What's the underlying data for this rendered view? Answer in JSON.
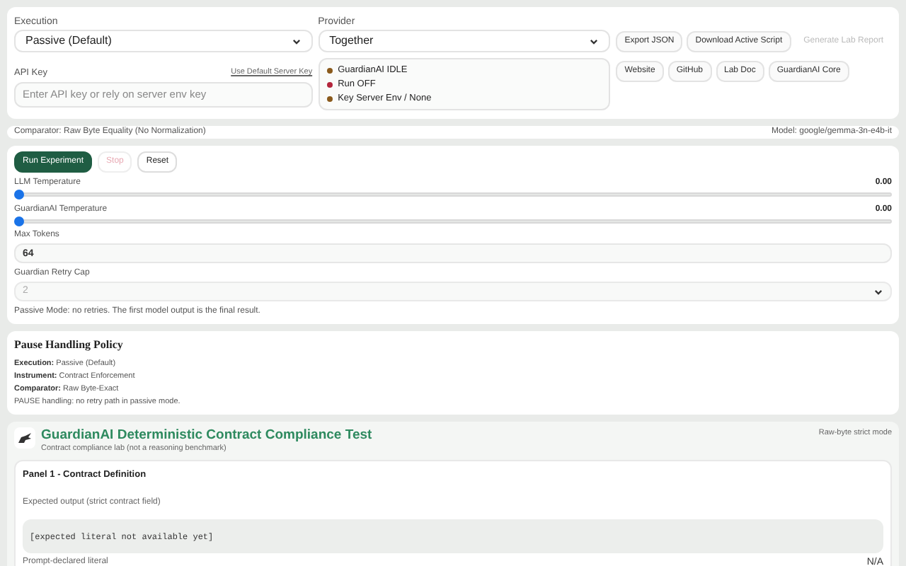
{
  "config": {
    "execution": {
      "label": "Execution",
      "value": "Passive (Default)"
    },
    "provider": {
      "label": "Provider",
      "value": "Together"
    },
    "api_key": {
      "label": "API Key",
      "link": "Use Default Server Key",
      "placeholder": "Enter API key or rely on server env key"
    },
    "status": [
      {
        "text": "GuardianAI IDLE",
        "color": "#8a5a1c"
      },
      {
        "text": "Run OFF",
        "color": "#b3263c"
      },
      {
        "text": "Key Server Env / None",
        "color": "#8a5a1c"
      }
    ],
    "actions": [
      {
        "label": "Export JSON",
        "disabled": false
      },
      {
        "label": "Download Active Script",
        "disabled": false
      },
      {
        "label": "Generate Lab Report",
        "disabled": true
      }
    ],
    "links": [
      "Website",
      "GitHub",
      "Lab Doc",
      "GuardianAI Core"
    ]
  },
  "info_bar": {
    "comparator": "Comparator: Raw Byte Equality (No Normalization)",
    "model": "Model: google/gemma-3n-e4b-it"
  },
  "controls": {
    "buttons": [
      {
        "label": "Run Experiment",
        "kind": "primary",
        "disabled": false
      },
      {
        "label": "Stop",
        "kind": "danger",
        "disabled": true
      },
      {
        "label": "Reset",
        "kind": "plain",
        "disabled": false
      }
    ],
    "sliders": [
      {
        "label": "LLM Temperature",
        "reading": "0.00",
        "level": 0
      },
      {
        "label": "GuardianAI Temperature",
        "reading": "0.00",
        "level": 0
      }
    ],
    "max_tokens": {
      "label": "Max Tokens",
      "value": "64"
    },
    "retry_cap": {
      "label": "Guardian Retry Cap",
      "value": "2",
      "disabled": true
    },
    "note": "Passive Mode: no retries. The first model output is the final result."
  },
  "policy": {
    "title": "Pause Handling Policy",
    "lines": [
      "**Execution:** Passive (Default)",
      "**Instrument:** Contract Enforcement",
      "**Comparator:** Raw Byte-Exact",
      "PAUSE handling: no retry path in passive mode."
    ]
  },
  "test": {
    "title": "GuardianAI Deterministic Contract Compliance Test",
    "subtitle": "Contract compliance lab (not a reasoning benchmark)",
    "mode": "Raw-byte strict mode",
    "panel": {
      "title": "Panel 1 - Contract Definition",
      "expected_label": "Expected output (strict contract field)",
      "expected_value": "[expected literal not available yet]",
      "declared_label": "Prompt-declared literal",
      "declared_value": "N/A"
    }
  }
}
